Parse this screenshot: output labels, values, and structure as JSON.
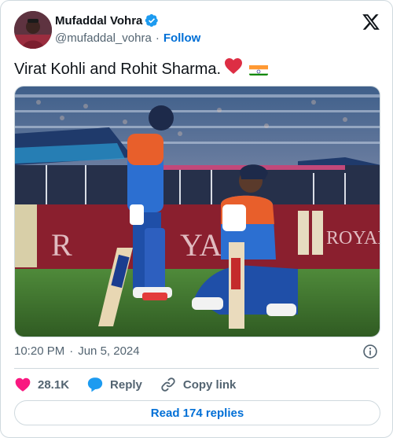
{
  "author": {
    "display_name": "Mufaddal Vohra",
    "handle": "@mufaddal_vohra",
    "verified": true,
    "follow_label": "Follow"
  },
  "icons": {
    "logo": "x-logo-icon",
    "verified": "verified-badge-icon",
    "info": "info-icon",
    "like": "heart-icon",
    "reply": "reply-bubble-icon",
    "copy": "link-icon"
  },
  "tweet": {
    "text": "Virat Kohli and Rohit Sharma.",
    "emojis": [
      "red-heart",
      "india-flag"
    ]
  },
  "meta": {
    "time": "10:20 PM",
    "separator": "·",
    "date": "Jun 5, 2024"
  },
  "actions": {
    "like_count": "28.1K",
    "reply_label": "Reply",
    "copy_label": "Copy link"
  },
  "read_replies_label": "Read 174 replies",
  "colors": {
    "link": "#006fd6",
    "verified": "#1d9bf0",
    "like": "#f91880",
    "reply": "#1d9bf0",
    "border": "#cfd9de",
    "secondary_text": "#536471"
  }
}
